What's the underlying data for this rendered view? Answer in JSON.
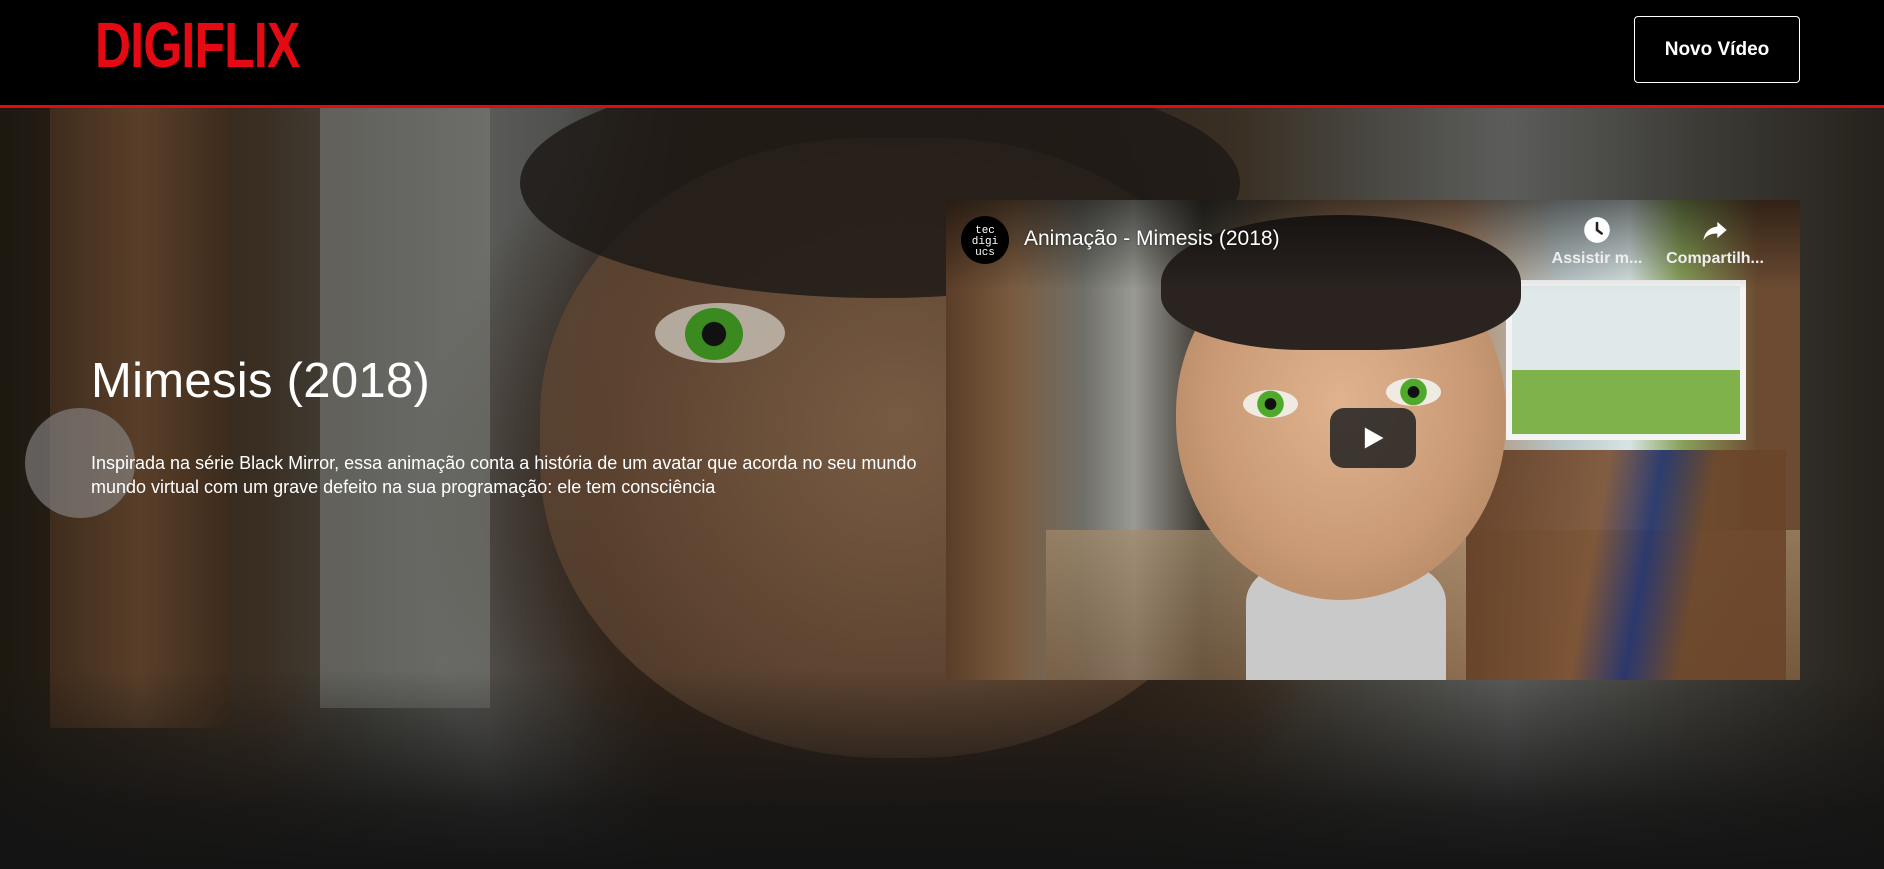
{
  "header": {
    "logo_text": "DIGIFLIX",
    "new_video_label": "Novo Vídeo"
  },
  "banner": {
    "title": "Mimesis (2018)",
    "description": "Inspirada na série Black Mirror, essa animação conta a história de um avatar que acorda no seu mundo mundo virtual com um grave defeito na sua programação: ele tem consciência"
  },
  "video": {
    "title": "Animação - Mimesis (2018)",
    "channel_avatar_lines": [
      "tec",
      "digi",
      "ucs"
    ],
    "watch_later_label": "Assistir m...",
    "share_label": "Compartilh...",
    "icons": {
      "watch_later": "clock-icon",
      "share": "share-arrow-icon",
      "play": "play-icon"
    }
  },
  "colors": {
    "brand": "#e50914",
    "header_bg": "#000000",
    "page_bg": "#141414"
  }
}
